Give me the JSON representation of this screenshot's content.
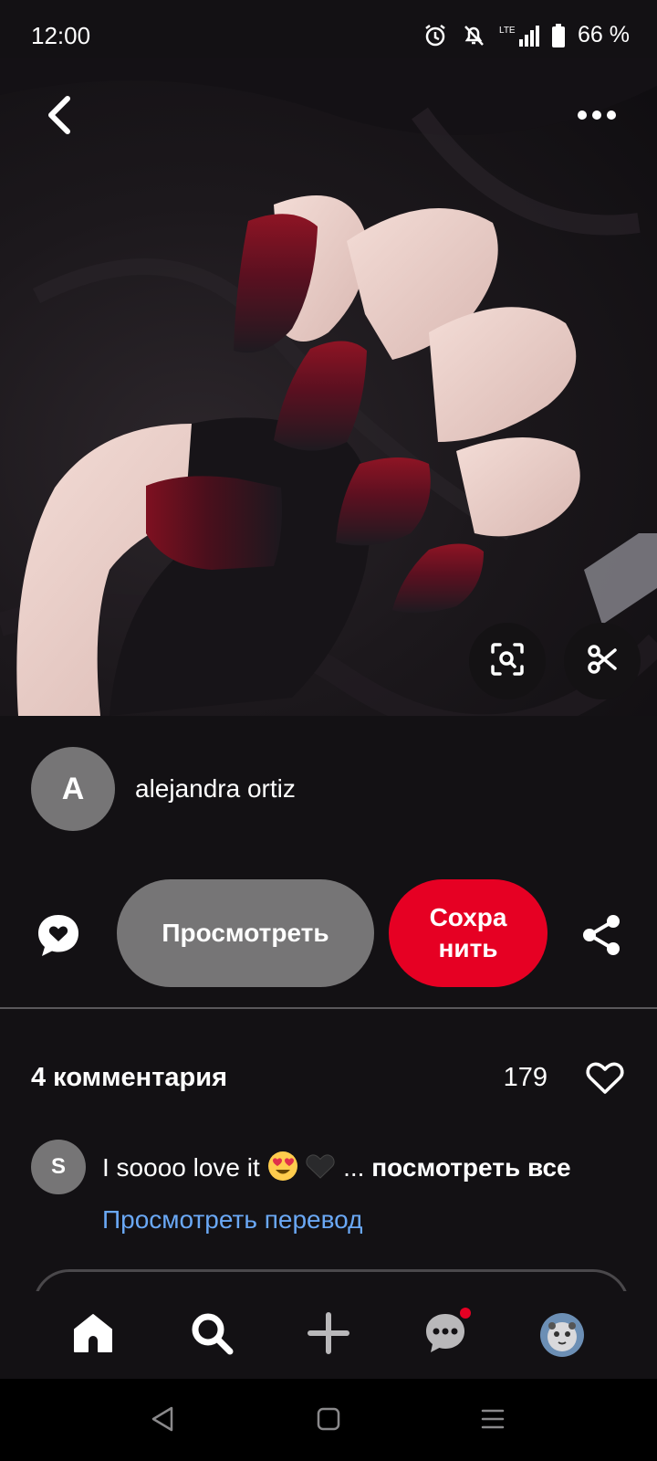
{
  "status_bar": {
    "time": "12:00",
    "network": "LTE",
    "battery": "66 %",
    "icons": [
      "alarm-icon",
      "notifications-off-icon",
      "signal-icon",
      "battery-icon"
    ]
  },
  "pin": {
    "image_alt": "",
    "top_actions": [
      "back-arrow-icon",
      "more-options-icon"
    ],
    "image_actions": [
      "visual-search-icon",
      "scissors-icon"
    ]
  },
  "author": {
    "initial": "A",
    "name": "alejandra ortiz"
  },
  "actions": {
    "view_label": "Просмотреть",
    "save_label": "Сохра нить",
    "colors": {
      "save": "#e60023",
      "view": "#767576"
    }
  },
  "comments": {
    "count_label": "4 комментария",
    "likes": "179",
    "items": [
      {
        "initial": "S",
        "text": "I soooo love it",
        "ellipsis": "...",
        "see_all": "посмотреть все",
        "translate": "Просмотреть перевод"
      }
    ]
  },
  "bottom_nav": {
    "items": [
      "home-icon",
      "search-icon",
      "create-icon",
      "messages-icon",
      "profile-avatar"
    ],
    "has_notification_dot": true
  },
  "system_nav": [
    "back-icon",
    "home-square-icon",
    "recents-icon"
  ]
}
